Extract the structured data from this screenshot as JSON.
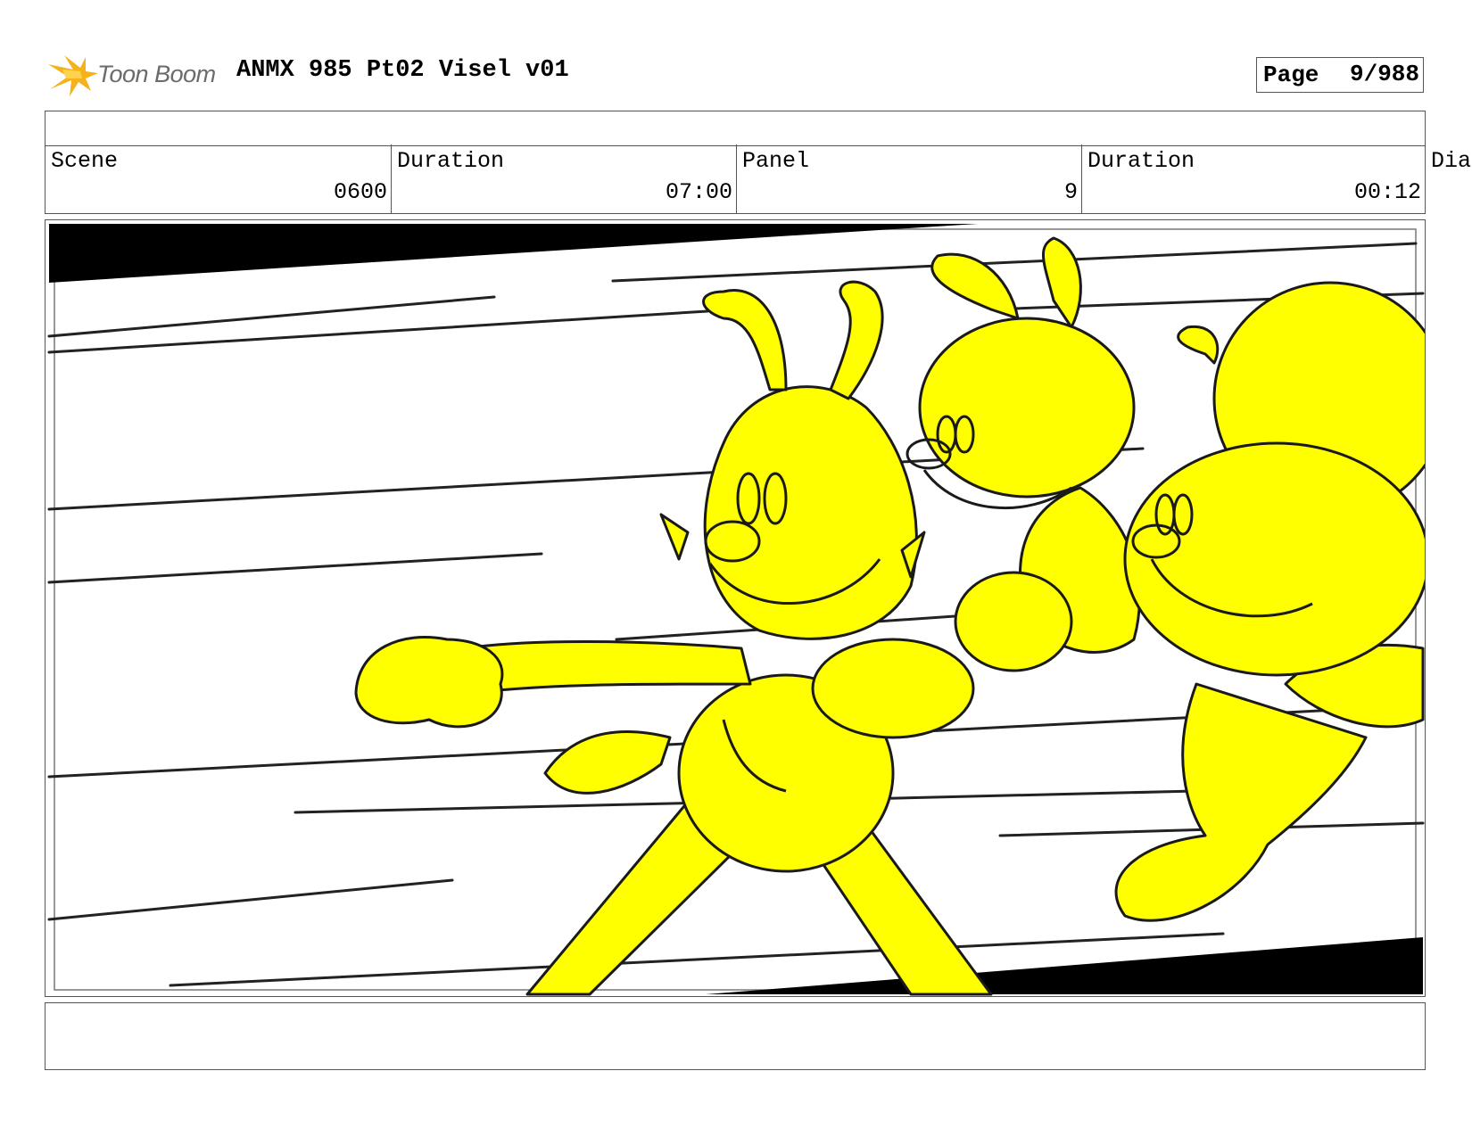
{
  "header": {
    "brand": "Toon Boom",
    "title": "ANMX 985 Pt02 Visel v01",
    "page_label": "Page",
    "page_number": "9/988"
  },
  "info": {
    "scene_label": "Scene",
    "scene_value": "0600",
    "scene_duration_label": "Duration",
    "scene_duration_value": "07:00",
    "panel_label": "Panel",
    "panel_value": "9",
    "panel_duration_label": "Duration",
    "panel_duration_value": "00:12",
    "dialogue_label": "Dia"
  },
  "colors": {
    "highlight_yellow": "#ffff00",
    "line": "#1a1a1a",
    "border": "#555555",
    "logo_orange": "#f5b21a"
  },
  "icons": {
    "logo": "starburst-icon"
  }
}
